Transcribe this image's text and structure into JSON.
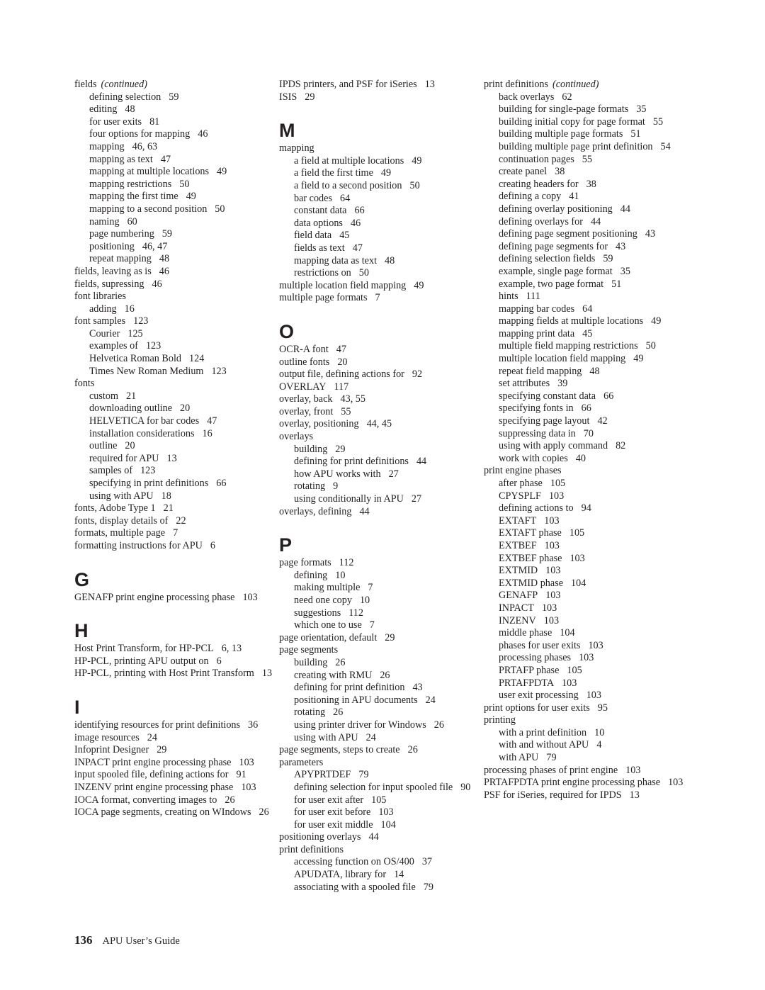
{
  "footer": {
    "page_number": "136",
    "book_title": "APU User’s Guide"
  },
  "continued_label": "(continued)",
  "columns": [
    [
      {
        "t": "main",
        "text": "fields",
        "cont": true
      },
      {
        "t": "sub",
        "text": "defining selection",
        "pages": "59"
      },
      {
        "t": "sub",
        "text": "editing",
        "pages": "48"
      },
      {
        "t": "sub",
        "text": "for user exits",
        "pages": "81"
      },
      {
        "t": "sub",
        "text": "four options for mapping",
        "pages": "46"
      },
      {
        "t": "sub",
        "text": "mapping",
        "pages": "46, 63"
      },
      {
        "t": "sub",
        "text": "mapping as text",
        "pages": "47"
      },
      {
        "t": "sub",
        "text": "mapping at multiple locations",
        "pages": "49"
      },
      {
        "t": "sub",
        "text": "mapping restrictions",
        "pages": "50"
      },
      {
        "t": "sub",
        "text": "mapping the first time",
        "pages": "49"
      },
      {
        "t": "sub",
        "text": "mapping to a second position",
        "pages": "50"
      },
      {
        "t": "sub",
        "text": "naming",
        "pages": "60"
      },
      {
        "t": "sub",
        "text": "page numbering",
        "pages": "59"
      },
      {
        "t": "sub",
        "text": "positioning",
        "pages": "46, 47"
      },
      {
        "t": "sub",
        "text": "repeat mapping",
        "pages": "48"
      },
      {
        "t": "main",
        "text": "fields, leaving as is",
        "pages": "46"
      },
      {
        "t": "main",
        "text": "fields, supressing",
        "pages": "46"
      },
      {
        "t": "main",
        "text": "font libraries"
      },
      {
        "t": "sub",
        "text": "adding",
        "pages": "16"
      },
      {
        "t": "main",
        "text": "font samples",
        "pages": "123"
      },
      {
        "t": "sub",
        "text": "Courier",
        "pages": "125"
      },
      {
        "t": "sub",
        "text": "examples of",
        "pages": "123"
      },
      {
        "t": "sub",
        "text": "Helvetica Roman Bold",
        "pages": "124"
      },
      {
        "t": "sub",
        "text": "Times New Roman Medium",
        "pages": "123"
      },
      {
        "t": "main",
        "text": "fonts"
      },
      {
        "t": "sub",
        "text": "custom",
        "pages": "21"
      },
      {
        "t": "sub",
        "text": "downloading outline",
        "pages": "20"
      },
      {
        "t": "sub",
        "text": "HELVETICA for bar codes",
        "pages": "47"
      },
      {
        "t": "sub",
        "text": "installation considerations",
        "pages": "16"
      },
      {
        "t": "sub",
        "text": "outline",
        "pages": "20"
      },
      {
        "t": "sub",
        "text": "required for APU",
        "pages": "13"
      },
      {
        "t": "sub",
        "text": "samples of",
        "pages": "123"
      },
      {
        "t": "sub",
        "text": "specifying in print definitions",
        "pages": "66"
      },
      {
        "t": "sub",
        "text": "using with APU",
        "pages": "18"
      },
      {
        "t": "main",
        "text": "fonts, Adobe Type 1",
        "pages": "21"
      },
      {
        "t": "main",
        "text": "fonts, display details of",
        "pages": "22"
      },
      {
        "t": "main",
        "text": "formats, multiple page",
        "pages": "7"
      },
      {
        "t": "main",
        "text": "formatting instructions for APU",
        "pages": "6"
      },
      {
        "t": "letter",
        "text": "G"
      },
      {
        "t": "main",
        "text": "GENAFP print engine processing phase",
        "pages": "103"
      },
      {
        "t": "letter",
        "text": "H"
      },
      {
        "t": "main",
        "text": "Host Print Transform, for HP-PCL",
        "pages": "6, 13"
      },
      {
        "t": "main",
        "text": "HP-PCL, printing APU output on",
        "pages": "6"
      },
      {
        "t": "main",
        "text": "HP-PCL, printing with Host Print Transform",
        "pages": "13"
      },
      {
        "t": "letter",
        "text": "I"
      },
      {
        "t": "main",
        "text": "identifying resources for print definitions",
        "pages": "36"
      },
      {
        "t": "main",
        "text": "image resources",
        "pages": "24"
      },
      {
        "t": "main",
        "text": "Infoprint Designer",
        "pages": "29"
      },
      {
        "t": "main",
        "text": "INPACT print engine processing phase",
        "pages": "103"
      },
      {
        "t": "main",
        "text": "input spooled file, defining actions for",
        "pages": "91"
      },
      {
        "t": "main",
        "text": "INZENV print engine processing phase",
        "pages": "103"
      },
      {
        "t": "main",
        "text": "IOCA format, converting images to",
        "pages": "26"
      },
      {
        "t": "main",
        "text": "IOCA page segments, creating on WIndows",
        "pages": "26"
      }
    ],
    [
      {
        "t": "main",
        "text": "IPDS printers, and PSF for iSeries",
        "pages": "13"
      },
      {
        "t": "main",
        "text": "ISIS",
        "pages": "29"
      },
      {
        "t": "letter",
        "text": "M"
      },
      {
        "t": "main",
        "text": "mapping"
      },
      {
        "t": "sub",
        "text": "a field at multiple locations",
        "pages": "49"
      },
      {
        "t": "sub",
        "text": "a field the first time",
        "pages": "49"
      },
      {
        "t": "sub",
        "text": "a field to a second position",
        "pages": "50"
      },
      {
        "t": "sub",
        "text": "bar codes",
        "pages": "64"
      },
      {
        "t": "sub",
        "text": "constant data",
        "pages": "66"
      },
      {
        "t": "sub",
        "text": "data options",
        "pages": "46"
      },
      {
        "t": "sub",
        "text": "field data",
        "pages": "45"
      },
      {
        "t": "sub",
        "text": "fields as text",
        "pages": "47"
      },
      {
        "t": "sub",
        "text": "mapping data as text",
        "pages": "48"
      },
      {
        "t": "sub",
        "text": "restrictions on",
        "pages": "50"
      },
      {
        "t": "main",
        "text": "multiple location field mapping",
        "pages": "49"
      },
      {
        "t": "main",
        "text": "multiple page formats",
        "pages": "7"
      },
      {
        "t": "letter",
        "text": "O"
      },
      {
        "t": "main",
        "text": "OCR-A font",
        "pages": "47"
      },
      {
        "t": "main",
        "text": "outline fonts",
        "pages": "20"
      },
      {
        "t": "main",
        "text": "output file, defining actions for",
        "pages": "92"
      },
      {
        "t": "main",
        "text": "OVERLAY",
        "pages": "117"
      },
      {
        "t": "main",
        "text": "overlay, back",
        "pages": "43, 55"
      },
      {
        "t": "main",
        "text": "overlay, front",
        "pages": "55"
      },
      {
        "t": "main",
        "text": "overlay, positioning",
        "pages": "44, 45"
      },
      {
        "t": "main",
        "text": "overlays"
      },
      {
        "t": "sub",
        "text": "building",
        "pages": "29"
      },
      {
        "t": "sub",
        "text": "defining for print definitions",
        "pages": "44"
      },
      {
        "t": "sub",
        "text": "how APU works with",
        "pages": "27"
      },
      {
        "t": "sub",
        "text": "rotating",
        "pages": "9"
      },
      {
        "t": "sub",
        "text": "using conditionally in APU",
        "pages": "27"
      },
      {
        "t": "main",
        "text": "overlays, defining",
        "pages": "44"
      },
      {
        "t": "letter",
        "text": "P"
      },
      {
        "t": "main",
        "text": "page formats",
        "pages": "112"
      },
      {
        "t": "sub",
        "text": "defining",
        "pages": "10"
      },
      {
        "t": "sub",
        "text": "making multiple",
        "pages": "7"
      },
      {
        "t": "sub",
        "text": "need one copy",
        "pages": "10"
      },
      {
        "t": "sub",
        "text": "suggestions",
        "pages": "112"
      },
      {
        "t": "sub",
        "text": "which one to use",
        "pages": "7"
      },
      {
        "t": "main",
        "text": "page orientation, default",
        "pages": "29"
      },
      {
        "t": "main",
        "text": "page segments"
      },
      {
        "t": "sub",
        "text": "building",
        "pages": "26"
      },
      {
        "t": "sub",
        "text": "creating with RMU",
        "pages": "26"
      },
      {
        "t": "sub",
        "text": "defining for print definition",
        "pages": "43"
      },
      {
        "t": "sub",
        "text": "positioning in APU documents",
        "pages": "24"
      },
      {
        "t": "sub",
        "text": "rotating",
        "pages": "26"
      },
      {
        "t": "sub",
        "text": "using printer driver for Windows",
        "pages": "26"
      },
      {
        "t": "sub",
        "text": "using with APU",
        "pages": "24"
      },
      {
        "t": "main",
        "text": "page segments, steps to create",
        "pages": "26"
      },
      {
        "t": "main",
        "text": "parameters"
      },
      {
        "t": "sub",
        "text": "APYPRTDEF",
        "pages": "79"
      },
      {
        "t": "sub",
        "text": "defining selection for input spooled file",
        "pages": "90"
      },
      {
        "t": "sub",
        "text": "for user exit after",
        "pages": "105"
      },
      {
        "t": "sub",
        "text": "for user exit before",
        "pages": "103"
      },
      {
        "t": "sub",
        "text": "for user exit middle",
        "pages": "104"
      },
      {
        "t": "main",
        "text": "positioning overlays",
        "pages": "44"
      },
      {
        "t": "main",
        "text": "print definitions"
      },
      {
        "t": "sub",
        "text": "accessing function on OS/400",
        "pages": "37"
      },
      {
        "t": "sub",
        "text": "APUDATA, library for",
        "pages": "14"
      },
      {
        "t": "sub",
        "text": "associating with a spooled file",
        "pages": "79"
      }
    ],
    [
      {
        "t": "main",
        "text": "print definitions",
        "cont": true
      },
      {
        "t": "sub",
        "text": "back overlays",
        "pages": "62"
      },
      {
        "t": "sub",
        "text": "building for single-page formats",
        "pages": "35"
      },
      {
        "t": "sub",
        "text": "building initial copy for page format",
        "pages": "55"
      },
      {
        "t": "sub",
        "text": "building multiple page formats",
        "pages": "51"
      },
      {
        "t": "sub",
        "text": "building multiple page print definition",
        "pages": "54"
      },
      {
        "t": "sub",
        "text": "continuation pages",
        "pages": "55"
      },
      {
        "t": "sub",
        "text": "create panel",
        "pages": "38"
      },
      {
        "t": "sub",
        "text": "creating headers for",
        "pages": "38"
      },
      {
        "t": "sub",
        "text": "defining a copy",
        "pages": "41"
      },
      {
        "t": "sub",
        "text": "defining overlay positioning",
        "pages": "44"
      },
      {
        "t": "sub",
        "text": "defining overlays for",
        "pages": "44"
      },
      {
        "t": "sub",
        "text": "defining page segment positioning",
        "pages": "43"
      },
      {
        "t": "sub",
        "text": "defining page segments for",
        "pages": "43"
      },
      {
        "t": "sub",
        "text": "defining selection fields",
        "pages": "59"
      },
      {
        "t": "sub",
        "text": "example, single page format",
        "pages": "35"
      },
      {
        "t": "sub",
        "text": "example, two page format",
        "pages": "51"
      },
      {
        "t": "sub",
        "text": "hints",
        "pages": "111"
      },
      {
        "t": "sub",
        "text": "mapping bar codes",
        "pages": "64"
      },
      {
        "t": "sub",
        "text": "mapping fields at multiple locations",
        "pages": "49"
      },
      {
        "t": "sub",
        "text": "mapping print data",
        "pages": "45"
      },
      {
        "t": "sub",
        "text": "multiple field mapping restrictions",
        "pages": "50"
      },
      {
        "t": "sub",
        "text": "multiple location field mapping",
        "pages": "49"
      },
      {
        "t": "sub",
        "text": "repeat field mapping",
        "pages": "48"
      },
      {
        "t": "sub",
        "text": "set attributes",
        "pages": "39"
      },
      {
        "t": "sub",
        "text": "specifying constant data",
        "pages": "66"
      },
      {
        "t": "sub",
        "text": "specifying fonts in",
        "pages": "66"
      },
      {
        "t": "sub",
        "text": "specifying page layout",
        "pages": "42"
      },
      {
        "t": "sub",
        "text": "suppressing data in",
        "pages": "70"
      },
      {
        "t": "sub",
        "text": "using with apply command",
        "pages": "82"
      },
      {
        "t": "sub",
        "text": "work with copies",
        "pages": "40"
      },
      {
        "t": "main",
        "text": "print engine phases"
      },
      {
        "t": "sub",
        "text": "after phase",
        "pages": "105"
      },
      {
        "t": "sub",
        "text": "CPYSPLF",
        "pages": "103"
      },
      {
        "t": "sub",
        "text": "defining actions to",
        "pages": "94"
      },
      {
        "t": "sub",
        "text": "EXTAFT",
        "pages": "103"
      },
      {
        "t": "sub",
        "text": "EXTAFT phase",
        "pages": "105"
      },
      {
        "t": "sub",
        "text": "EXTBEF",
        "pages": "103"
      },
      {
        "t": "sub",
        "text": "EXTBEF phase",
        "pages": "103"
      },
      {
        "t": "sub",
        "text": "EXTMID",
        "pages": "103"
      },
      {
        "t": "sub",
        "text": "EXTMID phase",
        "pages": "104"
      },
      {
        "t": "sub",
        "text": "GENAFP",
        "pages": "103"
      },
      {
        "t": "sub",
        "text": "INPACT",
        "pages": "103"
      },
      {
        "t": "sub",
        "text": "INZENV",
        "pages": "103"
      },
      {
        "t": "sub",
        "text": "middle phase",
        "pages": "104"
      },
      {
        "t": "sub",
        "text": "phases for user exits",
        "pages": "103"
      },
      {
        "t": "sub",
        "text": "processing phases",
        "pages": "103"
      },
      {
        "t": "sub",
        "text": "PRTAFP phase",
        "pages": "105"
      },
      {
        "t": "sub",
        "text": "PRTAFPDTA",
        "pages": "103"
      },
      {
        "t": "sub",
        "text": "user exit processing",
        "pages": "103"
      },
      {
        "t": "main",
        "text": "print options for user exits",
        "pages": "95"
      },
      {
        "t": "main",
        "text": "printing"
      },
      {
        "t": "sub",
        "text": "with a print definition",
        "pages": "10"
      },
      {
        "t": "sub",
        "text": "with and without APU",
        "pages": "4"
      },
      {
        "t": "sub",
        "text": "with APU",
        "pages": "79"
      },
      {
        "t": "main",
        "text": "processing phases of print engine",
        "pages": "103"
      },
      {
        "t": "main",
        "text": "PRTAFPDTA print engine processing phase",
        "pages": "103"
      },
      {
        "t": "main",
        "text": "PSF for iSeries, required for IPDS",
        "pages": "13"
      }
    ]
  ]
}
